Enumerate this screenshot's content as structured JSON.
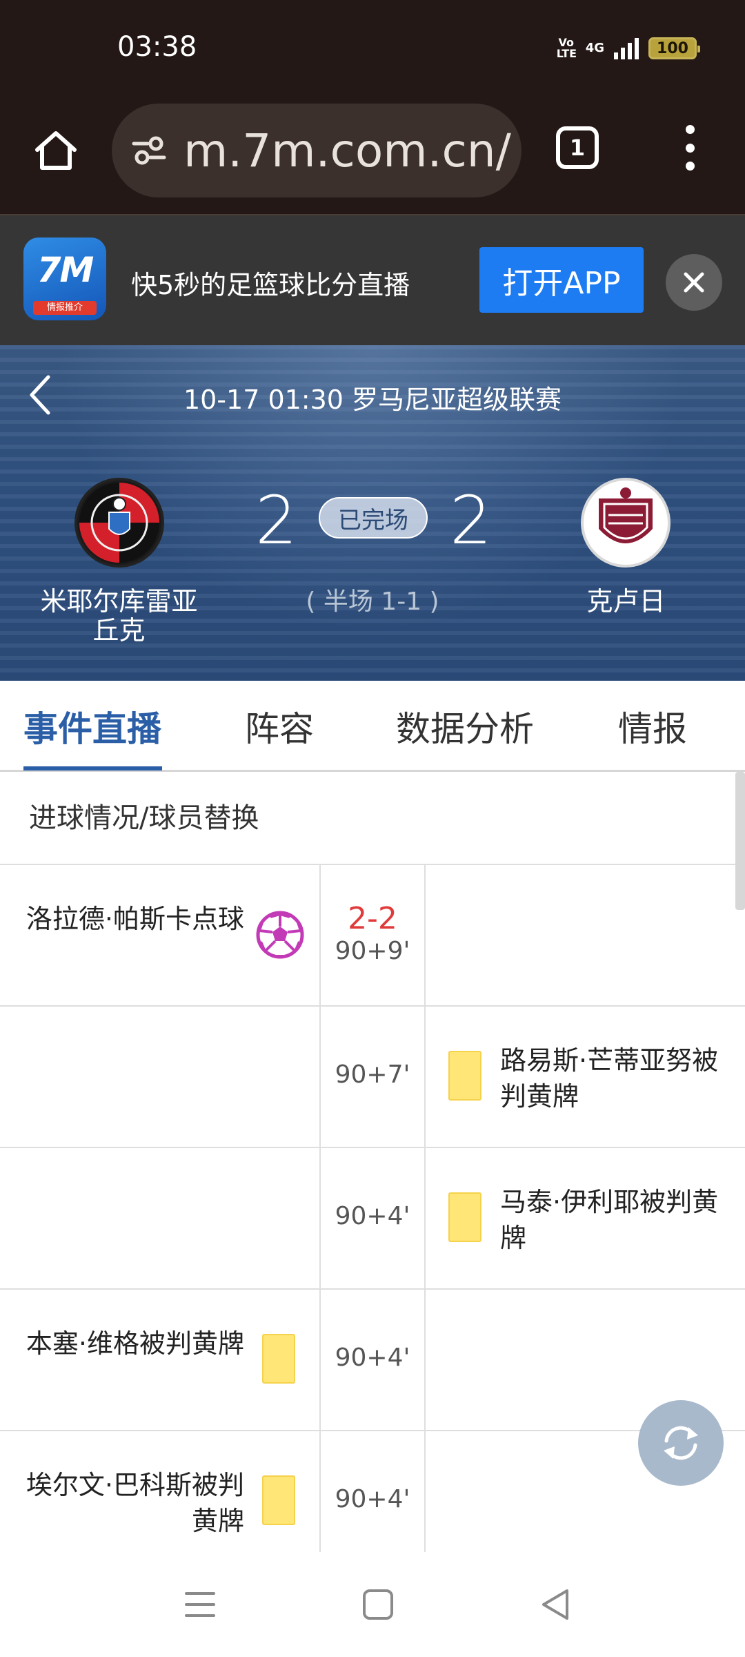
{
  "status_bar": {
    "time": "03:38",
    "volte_label": "Vo LTE",
    "network_label": "4G",
    "battery_level": "100"
  },
  "browser": {
    "url": "m.7m.com.cn/",
    "tab_count": "1"
  },
  "app_banner": {
    "logo_text": "7M",
    "logo_subtext": "情报推介",
    "tagline": "快5秒的足篮球比分直播",
    "open_button": "打开APP"
  },
  "match": {
    "info": "10-17 01:30 罗马尼亚超级联赛",
    "home_team": "米耶尔库雷亚丘克",
    "away_team": "克卢日",
    "home_score": "2",
    "away_score": "2",
    "status": "已完场",
    "halftime": "( 半场 1-1 )"
  },
  "tabs": [
    {
      "label": "事件直播",
      "active": true
    },
    {
      "label": "阵容",
      "active": false
    },
    {
      "label": "数据分析",
      "active": false
    },
    {
      "label": "情报",
      "active": false
    }
  ],
  "events_section": {
    "title": "进球情况/球员替换",
    "rows": [
      {
        "side": "home",
        "type": "penalty-goal",
        "text": "洛拉德·帕斯卡点球",
        "score": "2-2",
        "minute": "90+9'"
      },
      {
        "side": "away",
        "type": "yellow-card",
        "text": "路易斯·芒蒂亚努被判黄牌",
        "minute": "90+7'"
      },
      {
        "side": "away",
        "type": "yellow-card",
        "text": "马泰·伊利耶被判黄牌",
        "minute": "90+4'"
      },
      {
        "side": "home",
        "type": "yellow-card",
        "text": "本塞·维格被判黄牌",
        "minute": "90+4'"
      },
      {
        "side": "home",
        "type": "yellow-card",
        "text": "埃尔文·巴科斯被判黄牌",
        "minute": "90+4'"
      }
    ]
  },
  "colors": {
    "accent_blue": "#2a5ea7",
    "score_red": "#e03a3a",
    "yellow_card": "#ffe676",
    "open_app_blue": "#1e7cf2"
  },
  "icons": [
    "home-icon",
    "site-settings-icon",
    "tabs-icon",
    "more-icon",
    "close-icon",
    "back-icon",
    "soccer-ball-icon",
    "yellow-card-icon",
    "refresh-icon",
    "menu-icon",
    "square-icon",
    "back-triangle-icon"
  ]
}
